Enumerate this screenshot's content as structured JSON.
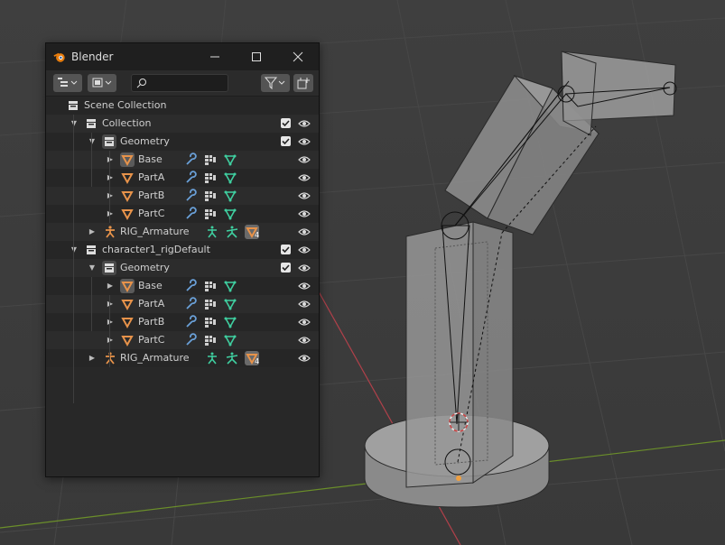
{
  "window": {
    "title": "Blender",
    "minimize_glyph": "—",
    "maximize_glyph": "☐",
    "close_glyph": "✕"
  },
  "toolbar": {
    "display_mode_icon": "outliner-display-icon",
    "view_layer_icon": "view-layer-icon",
    "search_placeholder": "",
    "filter_icon": "filter-icon",
    "new_collection_icon": "new-collection-icon"
  },
  "tree": {
    "rows": [
      {
        "label": "Scene Collection"
      },
      {
        "label": "Collection"
      },
      {
        "label": "Geometry"
      },
      {
        "label": "Base"
      },
      {
        "label": "PartA"
      },
      {
        "label": "PartB"
      },
      {
        "label": "PartC"
      },
      {
        "label": "RIG_Armature",
        "badge": "4"
      },
      {
        "label": "character1_rigDefault"
      },
      {
        "label": "Geometry"
      },
      {
        "label": "Base"
      },
      {
        "label": "PartA"
      },
      {
        "label": "PartB"
      },
      {
        "label": "PartC"
      },
      {
        "label": "RIG_Armature",
        "badge": "4"
      }
    ]
  },
  "colors": {
    "mesh_orange": "#e8934a",
    "modifier_blue": "#6aa0d8",
    "vgroup_green": "#3fcfa0",
    "bone_green": "#3fcfa0",
    "x_axis_red": "#b0404a",
    "y_axis_green": "#6b8f2a"
  }
}
